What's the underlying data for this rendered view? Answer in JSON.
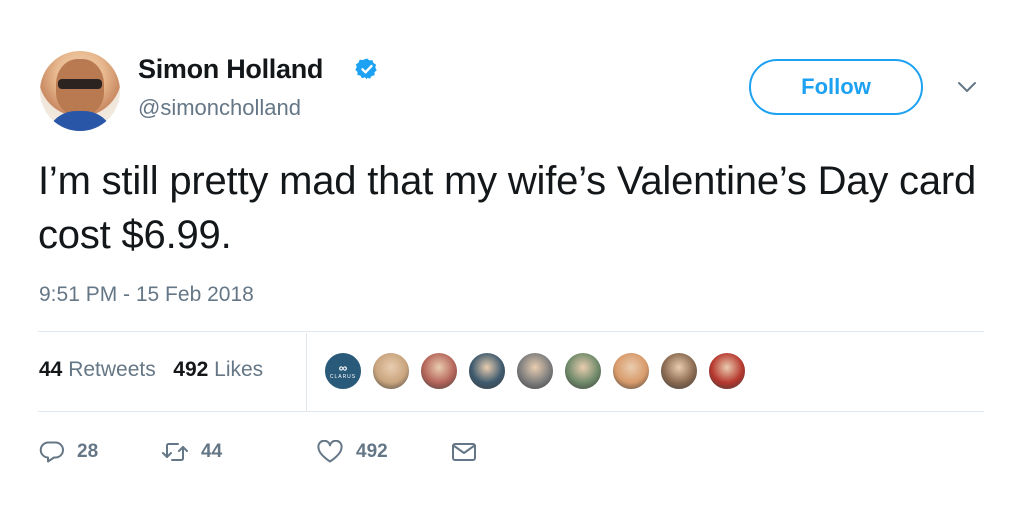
{
  "user": {
    "name": "Simon Holland",
    "handle": "@simoncholland",
    "verified": true
  },
  "follow_button": {
    "label": "Follow"
  },
  "tweet": {
    "text": "I’m still pretty mad that my wife’s Valentine’s Day card cost $6.99.",
    "timestamp": "9:51 PM - 15 Feb 2018"
  },
  "stats": {
    "retweets_count": "44",
    "retweets_label": "Retweets",
    "likes_count": "492",
    "likes_label": "Likes"
  },
  "likers": [
    {
      "id": "clarus",
      "logo_text": "CLARUS",
      "color": "#2a5a7a"
    },
    {
      "color": "#c9a47e"
    },
    {
      "color": "#b5655a"
    },
    {
      "color": "#3e5a6e"
    },
    {
      "color": "#7d7d7d"
    },
    {
      "color": "#6f8a6a"
    },
    {
      "color": "#d89a6a"
    },
    {
      "color": "#8a6a50"
    },
    {
      "color": "#b6382e"
    }
  ],
  "actions": {
    "reply_count": "28",
    "retweet_count": "44",
    "like_count": "492"
  },
  "icons": {
    "verified": "verified-badge-icon",
    "caret": "chevron-down-icon",
    "reply": "reply-icon",
    "retweet": "retweet-icon",
    "like": "heart-icon",
    "dm": "envelope-icon"
  },
  "colors": {
    "accent": "#1da1f2",
    "text": "#14171a",
    "secondary": "#657786",
    "divider": "#e1e8ed"
  }
}
